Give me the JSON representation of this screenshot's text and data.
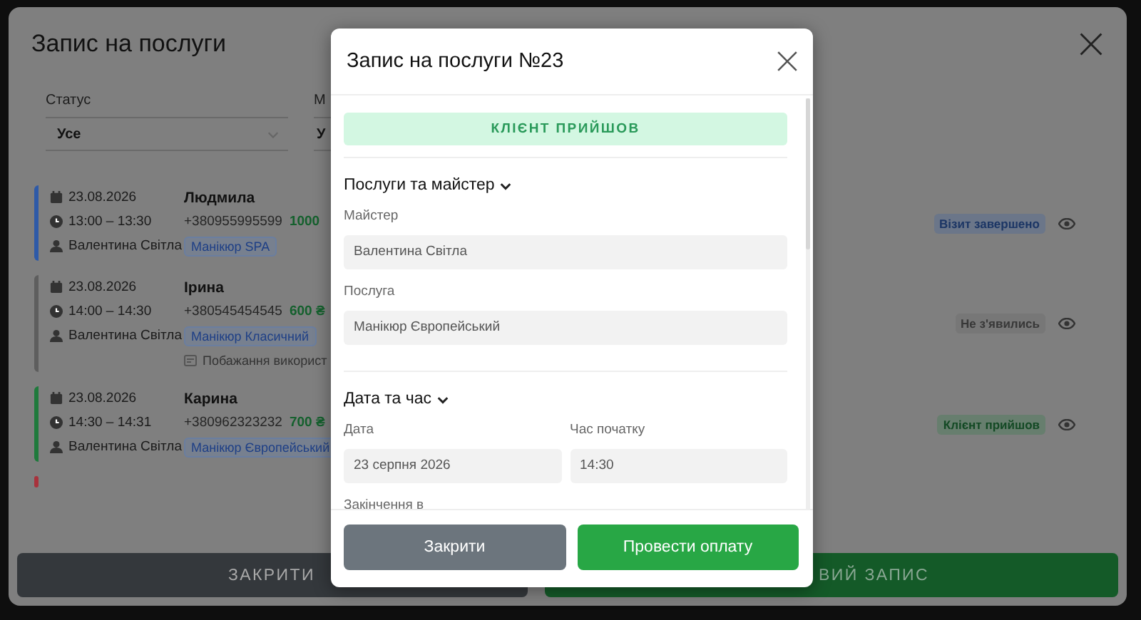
{
  "page": {
    "title": "Запис на послуги",
    "filters": [
      {
        "label": "Статус",
        "value": "Усе"
      },
      {
        "label": "М",
        "value": "У"
      }
    ],
    "appointments": [
      {
        "date": "23.08.2026",
        "time": "13:00 – 13:30",
        "master": "Валентина Світла",
        "client": "Людмила",
        "phone": "+380955995599",
        "price": "1000",
        "services": [
          "Манікюр SPA"
        ],
        "status": "Візит завершено",
        "color": "#2e5aa8"
      },
      {
        "date": "23.08.2026",
        "time": "14:00 – 14:30",
        "master": "Валентина Світла",
        "client": "Ірина",
        "phone": "+380545454545",
        "price": "600 ₴",
        "services": [
          "Манікюр Класичний"
        ],
        "note": "Побажання використ",
        "status": "Не з'явились",
        "color": "#5e5e5e"
      },
      {
        "date": "23.08.2026",
        "time": "14:30 – 14:31",
        "master": "Валентина Світла",
        "client": "Карина",
        "phone": "+380962323232",
        "price": "700 ₴",
        "services": [
          "Манікюр Європейський"
        ],
        "status": "Клієнт прийшов",
        "color": "#1f7a3c"
      },
      {
        "color": "#a8323c"
      }
    ],
    "buttons": [
      {
        "label": "ЗАКРИТИ",
        "kind": "secondary"
      },
      {
        "label": "ВИЙ ЗАПИС",
        "kind": "primary"
      }
    ]
  },
  "modal": {
    "title": "Запис на послуги №23",
    "status_banner": "КЛІЄНТ ПРИЙШОВ",
    "sections": [
      {
        "title": "Послуги та майстер",
        "expanded": true,
        "fields": [
          {
            "label": "Майстер",
            "value": "Валентина Світла"
          },
          {
            "label": "Послуга",
            "value": "Манікюр Європейський"
          }
        ]
      },
      {
        "title": "Дата та час",
        "expanded": true,
        "fields": [
          {
            "label": "Дата",
            "value": "23 серпня 2026"
          },
          {
            "label": "Час початку",
            "value": "14:30"
          },
          {
            "label": "Закінчення в"
          }
        ]
      }
    ],
    "buttons": [
      {
        "label": "Закрити",
        "kind": "secondary"
      },
      {
        "label": "Провести оплату",
        "kind": "primary"
      }
    ]
  }
}
